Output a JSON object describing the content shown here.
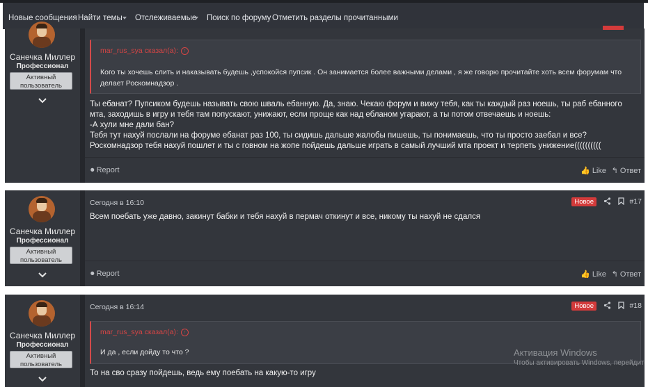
{
  "nav": {
    "items": [
      "Новые сообщения",
      "Найти темы",
      "Отслеживаемые",
      "Поиск по форуму",
      "Отметить разделы прочитанными"
    ]
  },
  "posts": [
    {
      "author": "Санечка Миллер",
      "title": "Профессионал",
      "badge": "Активный пользователь",
      "quote": {
        "author": "mar_rus_sya сказал(а):",
        "text": "Кого ты хочешь слить и наказывать будешь ,успокойся пупсик . Он занимается более важными делами , я же говорю прочитайте хоть всем форумам что делает Роскомнадзор ."
      },
      "message": "Ты ебанат? Пупсиком будешь называть свою шваль ебанную. Да, знаю. Чекаю форум и вижу тебя, как ты каждый раз ноешь, ты раб ебанного мта, заходишь в игру и тебя там попускают, унижают, если проще как над ебланом угарают, а ты потом отвечаешь и ноешь:\n-А хули мне дали бан?\nТебя тут нахуй послали на форуме ебанат раз 100, ты сидишь дальше жалобы пишешь, ты понимаешь, что ты просто заебал и все? Роскомнадзор тебя нахуй пошлет и ты с говном на жопе пойдешь дальше играть в самый лучший мта проект и терпеть унижение((((((((((",
      "report": "Report",
      "like": "Like",
      "reply": "Ответ"
    },
    {
      "author": "Санечка Миллер",
      "title": "Профессионал",
      "badge": "Активный пользователь",
      "date": "Сегодня в 16:10",
      "new": "Новое",
      "number": "#17",
      "message": "Всем поебать уже давно, закинут бабки и тебя нахуй в пермач откинут и все, никому ты нахуй не сдался",
      "report": "Report",
      "like": "Like",
      "reply": "Ответ"
    },
    {
      "author": "Санечка Миллер",
      "title": "Профессионал",
      "badge": "Активный пользователь",
      "date": "Сегодня в 16:14",
      "new": "Новое",
      "number": "#18",
      "quote": {
        "author": "mar_rus_sya сказал(а):",
        "text": "И да , если дойду то что ?"
      },
      "message": "То на сво сразу пойдешь, ведь ему поебать на какую-то игру"
    }
  ],
  "watermark": {
    "title": "Активация Windows",
    "subtitle": "Чтобы активировать Windows, перейдите в"
  },
  "colors": {
    "accent_red": "#d43b3b",
    "panel": "#33363c",
    "navbar": "#30333a"
  }
}
